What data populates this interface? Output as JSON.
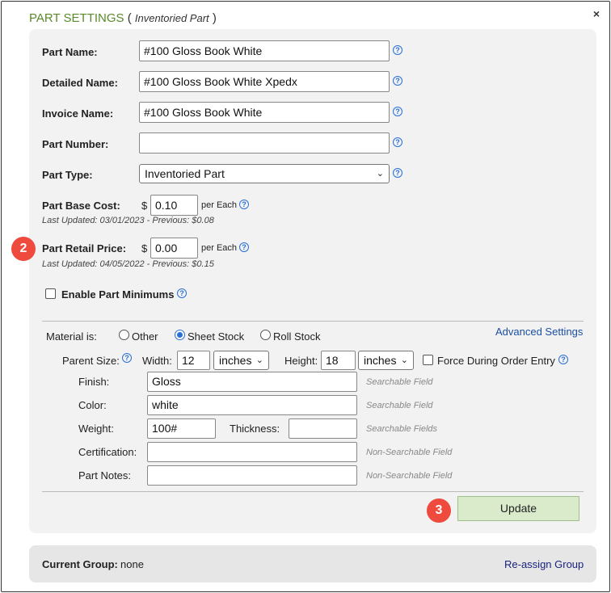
{
  "dialog": {
    "title": "PART SETTINGS",
    "title_open": " ( ",
    "subtitle": "Inventoried Part",
    "title_close": " )",
    "close_label": "×"
  },
  "fields": {
    "part_name": {
      "label": "Part Name:",
      "value": "#100 Gloss Book White"
    },
    "detailed_name": {
      "label": "Detailed Name:",
      "value": "#100 Gloss Book White Xpedx"
    },
    "invoice_name": {
      "label": "Invoice Name:",
      "value": "#100 Gloss Book White"
    },
    "part_number": {
      "label": "Part Number:",
      "value": ""
    },
    "part_type": {
      "label": "Part Type:",
      "value": "Inventoried Part"
    },
    "base_cost": {
      "label": "Part Base Cost:",
      "currency": "$",
      "value": "0.10",
      "unit": "per Each",
      "updated": "Last Updated: 03/01/2023 - Previous: $0.08"
    },
    "retail_price": {
      "label": "Part Retail Price:",
      "currency": "$",
      "value": "0.00",
      "unit": "per Each",
      "updated": "Last Updated: 04/05/2022 - Previous: $0.15"
    },
    "enable_minimums": {
      "label": "Enable Part Minimums",
      "checked": false
    }
  },
  "material": {
    "label": "Material is:",
    "options": [
      "Other",
      "Sheet Stock",
      "Roll Stock"
    ],
    "selected": "Sheet Stock",
    "advanced_link": "Advanced Settings"
  },
  "parent_size": {
    "label": "Parent Size:",
    "width_label": "Width:",
    "width_value": "12",
    "width_unit": "inches",
    "height_label": "Height:",
    "height_value": "18",
    "height_unit": "inches",
    "force_label": "Force During Order Entry"
  },
  "specs": {
    "finish": {
      "label": "Finish:",
      "value": "Gloss",
      "hint": "Searchable Field"
    },
    "color": {
      "label": "Color:",
      "value": "white",
      "hint": "Searchable Field"
    },
    "weight": {
      "label": "Weight:",
      "value": "100#",
      "thickness_label": "Thickness:",
      "thickness_value": "",
      "hint": "Searchable Fields"
    },
    "certification": {
      "label": "Certification:",
      "value": "",
      "hint": "Non-Searchable Field"
    },
    "part_notes": {
      "label": "Part Notes:",
      "value": "",
      "hint": "Non-Searchable Field"
    }
  },
  "update_label": "Update",
  "group": {
    "label": "Current Group:",
    "value": "none",
    "reassign_link": "Re-assign Group"
  },
  "badges": {
    "retail_step": "2",
    "update_step": "3"
  },
  "colors": {
    "title_green": "#5a8a2a",
    "badge_red": "#ee4b3e",
    "update_bg": "#d9ebca",
    "link_blue": "#1a4fa0",
    "help_blue": "#2a6fd6"
  }
}
